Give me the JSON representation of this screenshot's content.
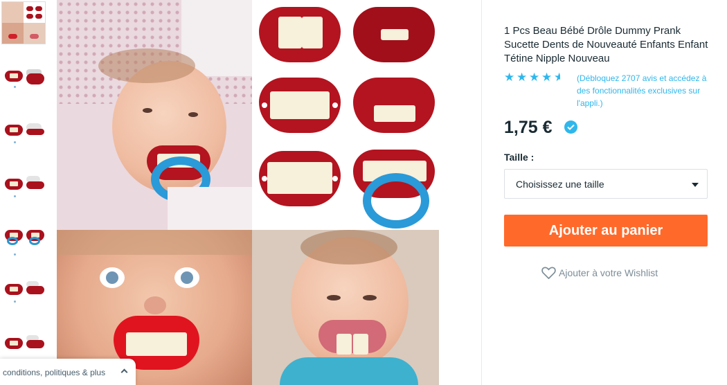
{
  "product": {
    "title": "1 Pcs Beau Bébé Drôle Dummy Prank Sucette Dents de Nouveauté Enfants Enfant Tétine Nipple Nouveau",
    "rating": 4.5,
    "rating_max": 5,
    "rating_note": "(Débloquez 2707 avis et accédez à des fonctionnalités exclusives sur l'appli.)",
    "price": "1,75 €",
    "size_label": "Taille :",
    "size_select_value": "Choisissez une taille",
    "add_to_cart_label": "Ajouter au panier",
    "wishlist_label": "Ajouter à votre Wishlist"
  },
  "footer_tab": {
    "label": "conditions, politiques & plus"
  },
  "thumbnails": {
    "count": 7,
    "selected_index": 0
  },
  "colors": {
    "accent_blue": "#2fb7ec",
    "cart_orange": "#ff6a2b",
    "text_dark": "#192a32",
    "text_muted": "#7d8d98"
  },
  "icons": {
    "star": "star-icon",
    "verified": "verified-check-icon",
    "select": "chevron-down-icon",
    "wishlist": "heart-outline-icon",
    "footer": "chevron-up-icon"
  }
}
